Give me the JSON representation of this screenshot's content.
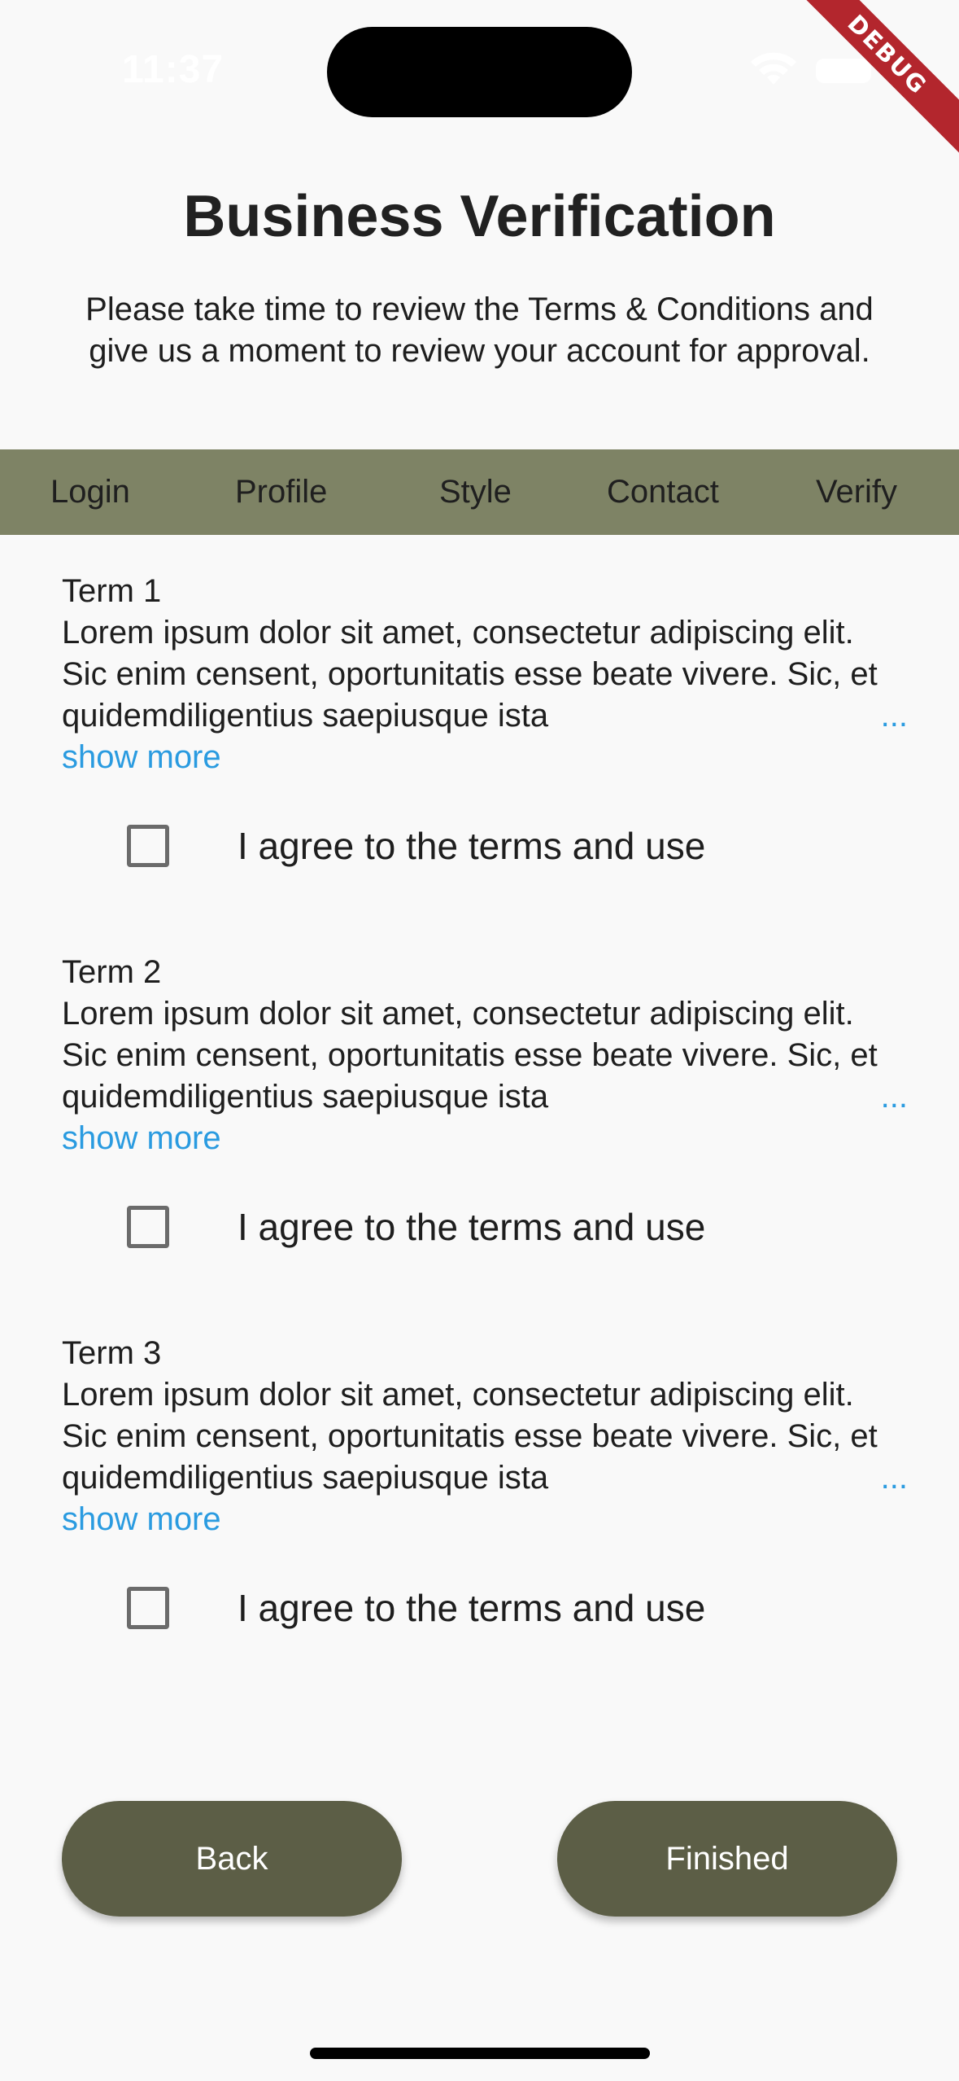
{
  "status_bar": {
    "time": "11:37",
    "debug_label": "DEBUG"
  },
  "header": {
    "title": "Business Verification",
    "subtitle": "Please take time to review the Terms & Conditions and give us a moment to review your account for approval."
  },
  "tabs": [
    {
      "label": "Login"
    },
    {
      "label": "Profile"
    },
    {
      "label": "Style"
    },
    {
      "label": "Contact"
    },
    {
      "label": "Verify"
    }
  ],
  "terms": [
    {
      "title": "Term 1",
      "body": "Lorem ipsum dolor sit amet, consectetur adipiscing elit. Sic enim censent, oportunitatis esse beate vivere. Sic, et quidemdiligentius saepiusque ista",
      "ellipsis": "...",
      "show_more": "show more",
      "agree_label": "I agree to the terms and use",
      "checked": false
    },
    {
      "title": "Term 2",
      "body": "Lorem ipsum dolor sit amet, consectetur adipiscing elit. Sic enim censent, oportunitatis esse beate vivere. Sic, et quidemdiligentius saepiusque ista",
      "ellipsis": "...",
      "show_more": "show more",
      "agree_label": "I agree to the terms and use",
      "checked": false
    },
    {
      "title": "Term 3",
      "body": "Lorem ipsum dolor sit amet, consectetur adipiscing elit. Sic enim censent, oportunitatis esse beate vivere. Sic, et quidemdiligentius saepiusque ista",
      "ellipsis": "...",
      "show_more": "show more",
      "agree_label": "I agree to the terms and use",
      "checked": false
    }
  ],
  "buttons": {
    "back": "Back",
    "finished": "Finished"
  },
  "colors": {
    "tab_bar": "#7e8365",
    "button": "#5c5e46",
    "link": "#2a9be0",
    "background": "#f9f9f9"
  }
}
